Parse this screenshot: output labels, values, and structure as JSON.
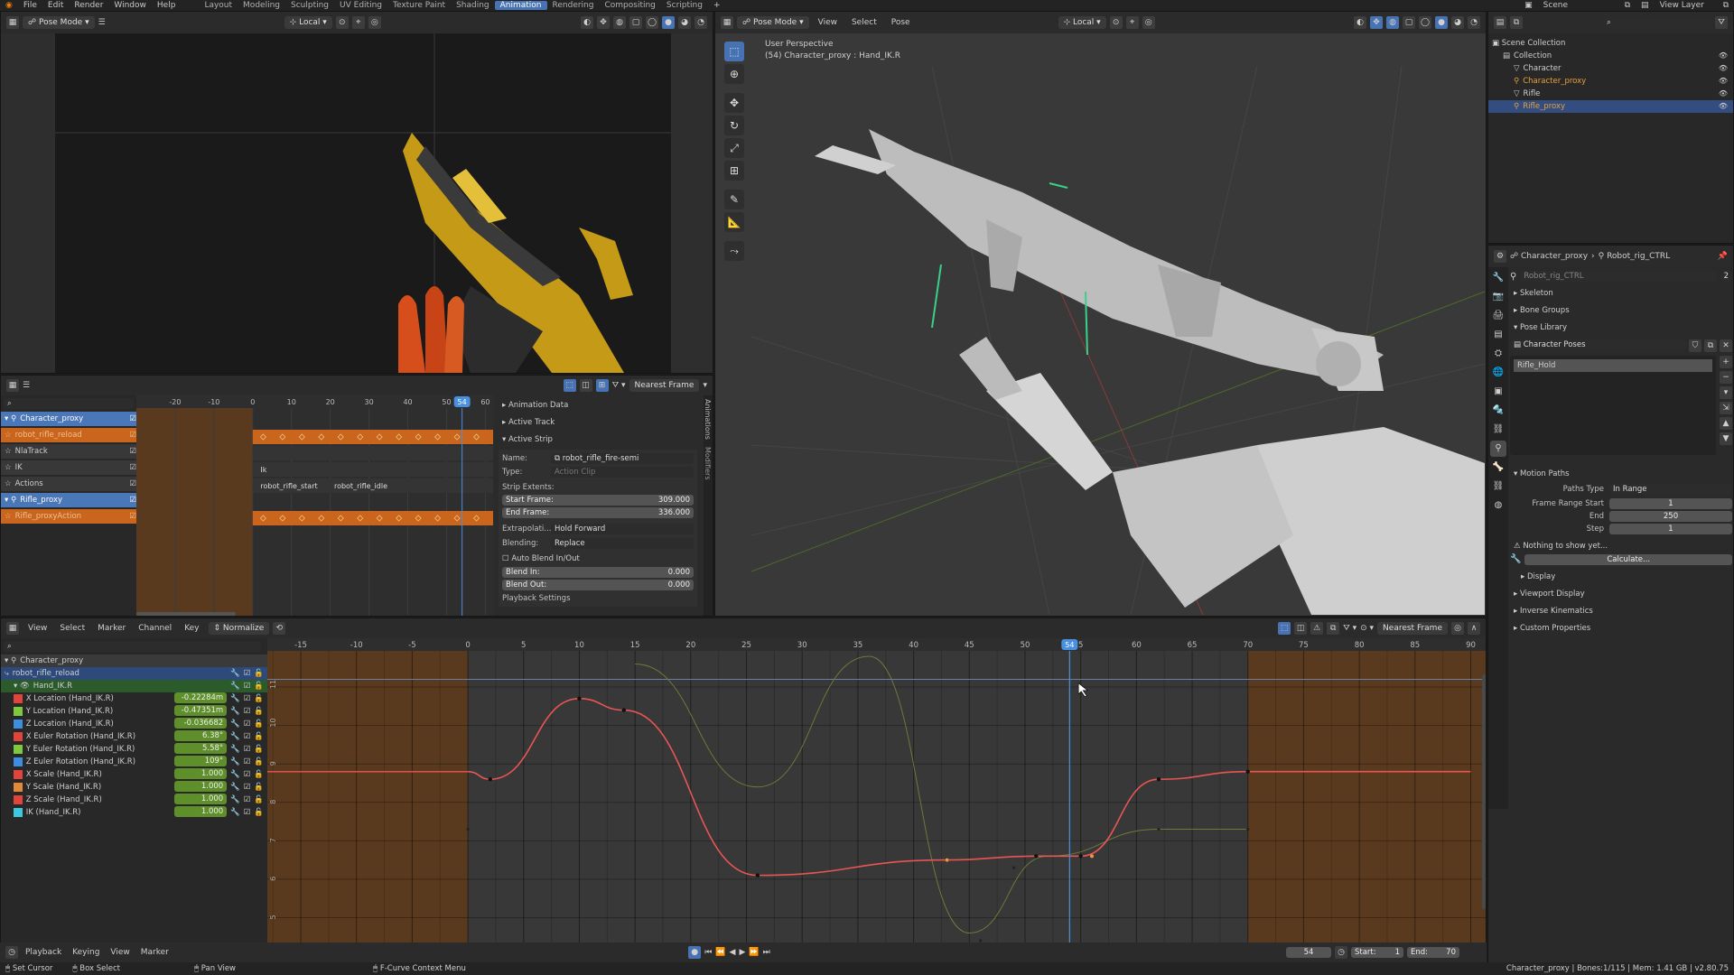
{
  "topbar": {
    "menus": [
      "File",
      "Edit",
      "Render",
      "Window",
      "Help"
    ],
    "workspaces": [
      {
        "label": "Layout",
        "active": false
      },
      {
        "label": "Modeling",
        "active": false
      },
      {
        "label": "Sculpting",
        "active": false
      },
      {
        "label": "UV Editing",
        "active": false
      },
      {
        "label": "Texture Paint",
        "active": false
      },
      {
        "label": "Shading",
        "active": false
      },
      {
        "label": "Animation",
        "active": true
      },
      {
        "label": "Rendering",
        "active": false
      },
      {
        "label": "Compositing",
        "active": false
      },
      {
        "label": "Scripting",
        "active": false
      }
    ],
    "add_tab": "+",
    "scene": "Scene",
    "view_layer": "View Layer"
  },
  "camview": {
    "mode": "Pose Mode",
    "orientation": "Local"
  },
  "viewport": {
    "mode": "Pose Mode",
    "menus": [
      "View",
      "Select",
      "Pose"
    ],
    "orientation": "Local",
    "overlay_title": "User Perspective",
    "overlay_sub": "(54) Character_proxy : Hand_IK.R"
  },
  "outliner": {
    "root": "Scene Collection",
    "items": [
      {
        "label": "Collection",
        "indent": 1,
        "selected": false
      },
      {
        "label": "Character",
        "indent": 2,
        "selected": false
      },
      {
        "label": "Character_proxy",
        "indent": 2,
        "selected": false,
        "orange": true
      },
      {
        "label": "Rifle",
        "indent": 2,
        "selected": false
      },
      {
        "label": "Rifle_proxy",
        "indent": 2,
        "selected": true,
        "orange": true
      }
    ]
  },
  "props": {
    "breadcrumb_obj": "Character_proxy",
    "breadcrumb_rig": "Robot_rig_CTRL",
    "data_name": "Robot_rig_CTRL",
    "user_count": "2",
    "sections": [
      "Skeleton",
      "Bone Groups",
      "Pose Library"
    ],
    "pose_lib_name": "Character Poses",
    "pose_item": "Rifle_Hold",
    "motion_paths": "Motion Paths",
    "paths_type_label": "Paths Type",
    "paths_type_value": "In Range",
    "frame_range_start_label": "Frame Range Start",
    "frame_range_start": "1",
    "end_label": "End",
    "end": "250",
    "step_label": "Step",
    "step": "1",
    "warning": "Nothing to show yet...",
    "calculate": "Calculate...",
    "display": "Display",
    "more_sections": [
      "Viewport Display",
      "Inverse Kinematics",
      "Custom Properties"
    ]
  },
  "nla": {
    "snap": "Nearest Frame",
    "ticks": [
      "-20",
      "-10",
      "0",
      "10",
      "20",
      "30",
      "40",
      "50",
      "60"
    ],
    "current_frame": "54",
    "tracks": [
      {
        "label": "Character_proxy",
        "type": "object"
      },
      {
        "label": "robot_rifle_reload",
        "type": "action"
      },
      {
        "label": "NlaTrack",
        "type": "track"
      },
      {
        "label": "IK",
        "type": "track"
      },
      {
        "label": "Actions",
        "type": "track"
      },
      {
        "label": "Rifle_proxy",
        "type": "object"
      },
      {
        "label": "Rifle_proxyAction",
        "type": "action"
      }
    ],
    "strip_ik": "Ik",
    "strip_start": "robot_rifle_start",
    "strip_idle": "robot_rifle_idle"
  },
  "sidebar": {
    "sections": [
      "Animation Data",
      "Active Track",
      "Active Strip"
    ],
    "name_label": "Name:",
    "name_value": "robot_rifle_fire-semi",
    "type_label": "Type:",
    "type_value": "Action Clip",
    "extents": "Strip Extents:",
    "start_label": "Start Frame:",
    "start_value": "309.000",
    "end_label": "End Frame:",
    "end_value": "336.000",
    "extrap_label": "Extrapolati...",
    "extrap_value": "Hold Forward",
    "blend_label": "Blending:",
    "blend_value": "Replace",
    "auto_blend": "Auto Blend In/Out",
    "blend_in_label": "Blend In:",
    "blend_in": "0.000",
    "blend_out_label": "Blend Out:",
    "blend_out": "0.000",
    "playback": "Playback Settings",
    "tabs": [
      "Animations",
      "Modifiers"
    ]
  },
  "graph": {
    "menus": [
      "View",
      "Select",
      "Marker",
      "Channel",
      "Key"
    ],
    "normalize": "Normalize",
    "snap": "Nearest Frame",
    "x_ticks": [
      {
        "f": -15,
        "l": "-15"
      },
      {
        "f": -10,
        "l": "-10"
      },
      {
        "f": -5,
        "l": "-5"
      },
      {
        "f": 0,
        "l": "0"
      },
      {
        "f": 5,
        "l": "5"
      },
      {
        "f": 10,
        "l": "10"
      },
      {
        "f": 15,
        "l": "15"
      },
      {
        "f": 20,
        "l": "20"
      },
      {
        "f": 25,
        "l": "25"
      },
      {
        "f": 30,
        "l": "30"
      },
      {
        "f": 35,
        "l": "35"
      },
      {
        "f": 40,
        "l": "40"
      },
      {
        "f": 45,
        "l": "45"
      },
      {
        "f": 50,
        "l": "50"
      },
      {
        "f": 55,
        "l": "5"
      },
      {
        "f": 60,
        "l": "60"
      },
      {
        "f": 65,
        "l": "65"
      },
      {
        "f": 70,
        "l": "70"
      },
      {
        "f": 75,
        "l": "75"
      },
      {
        "f": 80,
        "l": "80"
      },
      {
        "f": 85,
        "l": "85"
      },
      {
        "f": 90,
        "l": "90"
      }
    ],
    "y_ticks": [
      {
        "v": 11,
        "l": "11"
      },
      {
        "v": 10,
        "l": "10"
      },
      {
        "v": 9,
        "l": "9"
      },
      {
        "v": 8,
        "l": "8"
      },
      {
        "v": 7,
        "l": "7"
      },
      {
        "v": 6,
        "l": "6"
      },
      {
        "v": 5,
        "l": "5"
      }
    ],
    "current_frame": "54",
    "channels": [
      {
        "label": "Character_proxy",
        "value": "",
        "color": "",
        "kind": "object"
      },
      {
        "label": "robot_rifle_reload",
        "value": "",
        "color": "",
        "kind": "action"
      },
      {
        "label": "Hand_IK.R",
        "value": "",
        "color": "",
        "kind": "group"
      },
      {
        "label": "X Location (Hand_IK.R)",
        "value": "-0.22284m",
        "color": "#e0443a",
        "kind": "curve"
      },
      {
        "label": "Y Location (Hand_IK.R)",
        "value": "-0.47351m",
        "color": "#7fc93c",
        "kind": "curve"
      },
      {
        "label": "Z Location (Hand_IK.R)",
        "value": "-0.036682",
        "color": "#3c8fe0",
        "kind": "curve"
      },
      {
        "label": "X Euler Rotation (Hand_IK.R)",
        "value": "6.38°",
        "color": "#e0443a",
        "kind": "curve"
      },
      {
        "label": "Y Euler Rotation (Hand_IK.R)",
        "value": "5.58°",
        "color": "#7fc93c",
        "kind": "curve"
      },
      {
        "label": "Z Euler Rotation (Hand_IK.R)",
        "value": "109°",
        "color": "#3c8fe0",
        "kind": "curve"
      },
      {
        "label": "X Scale (Hand_IK.R)",
        "value": "1.000",
        "color": "#e0443a",
        "kind": "curve"
      },
      {
        "label": "Y Scale (Hand_IK.R)",
        "value": "1.000",
        "color": "#e08a3a",
        "kind": "curve"
      },
      {
        "label": "Z Scale (Hand_IK.R)",
        "value": "1.000",
        "color": "#e0443a",
        "kind": "curve"
      },
      {
        "label": "IK (Hand_IK.R)",
        "value": "1.000",
        "color": "#3cc8e0",
        "kind": "curve"
      }
    ],
    "curve_red": [
      [
        0,
        8.8
      ],
      [
        2,
        8.6
      ],
      [
        10,
        10.7
      ],
      [
        14,
        10.4
      ],
      [
        26,
        6.1
      ],
      [
        43,
        6.5
      ],
      [
        51,
        6.6
      ],
      [
        55,
        6.6
      ],
      [
        62,
        8.6
      ],
      [
        70,
        8.8
      ],
      [
        90,
        8.8
      ]
    ],
    "curve_green": [
      [
        15,
        11.6
      ],
      [
        26,
        8.4
      ],
      [
        36,
        11.8
      ],
      [
        45,
        4.6
      ],
      [
        52,
        6.6
      ],
      [
        62,
        7.3
      ],
      [
        70,
        7.3
      ]
    ],
    "curve_key_dots": [
      [
        2,
        8.6
      ],
      [
        10,
        10.7
      ],
      [
        14,
        10.4
      ],
      [
        26,
        6.1
      ],
      [
        43,
        6.5
      ],
      [
        51,
        6.6
      ],
      [
        55,
        6.6
      ],
      [
        62,
        8.6
      ],
      [
        70,
        8.8
      ]
    ],
    "green_key_dots": [
      [
        0,
        7.3
      ],
      [
        49,
        6.3
      ],
      [
        62,
        7.3
      ],
      [
        70,
        7.3
      ],
      [
        46,
        4.4
      ]
    ]
  },
  "playback": {
    "menus": [
      "Playback",
      "Keying",
      "View",
      "Marker"
    ],
    "frame": "54",
    "start_label": "Start:",
    "start": "1",
    "end_label": "End:",
    "end": "70"
  },
  "status": {
    "items": [
      "Set Cursor",
      "Box Select",
      "Pan View",
      "F-Curve Context Menu"
    ],
    "right": "Character_proxy | Bones:1/115 | Mem: 1.41 GB | v2.80.75"
  }
}
